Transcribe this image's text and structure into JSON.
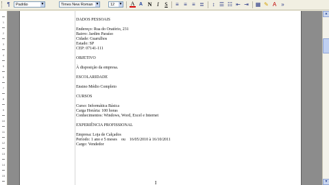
{
  "toolbar": {
    "font_name": "Times New Roman",
    "font_size": "12",
    "style_name": "Padrão",
    "bold": "N",
    "italic": "I",
    "underline": "S",
    "font_color_letter": "A"
  },
  "document": {
    "lines": [
      "DADOS PESSOAIS",
      "",
      "Endereço: Rua do Oratório, 231",
      "Bairro: Jardim Paraíso",
      "Cidade: Guarulhos",
      "Estado: SP",
      "CEP: 07141-111",
      "",
      "OBJETIVO",
      "",
      "À disposição da empresa.",
      "",
      "ESCOLARIDADE",
      "",
      "Ensino Médio Completo",
      "",
      "CURSOS",
      "",
      "Curso: Informática Básica",
      "Carga Horária: 100 horas",
      "Conhecimentos: Windows, Word, Excel e Internet",
      "",
      "EXPERIÊNCIA PROFISSIONAL",
      "",
      "Empresa: Loja de Calçados",
      "Período: 1 ano e 5 meses    ou    16/05/2010 à 16/10/2011",
      "Cargo: Vendedor"
    ]
  },
  "ruler": {
    "numbers": [
      "1",
      "2",
      "3",
      "4",
      "5",
      "6",
      "7",
      "8",
      "9",
      "10",
      "11",
      "12",
      "13",
      "14",
      "15"
    ]
  }
}
